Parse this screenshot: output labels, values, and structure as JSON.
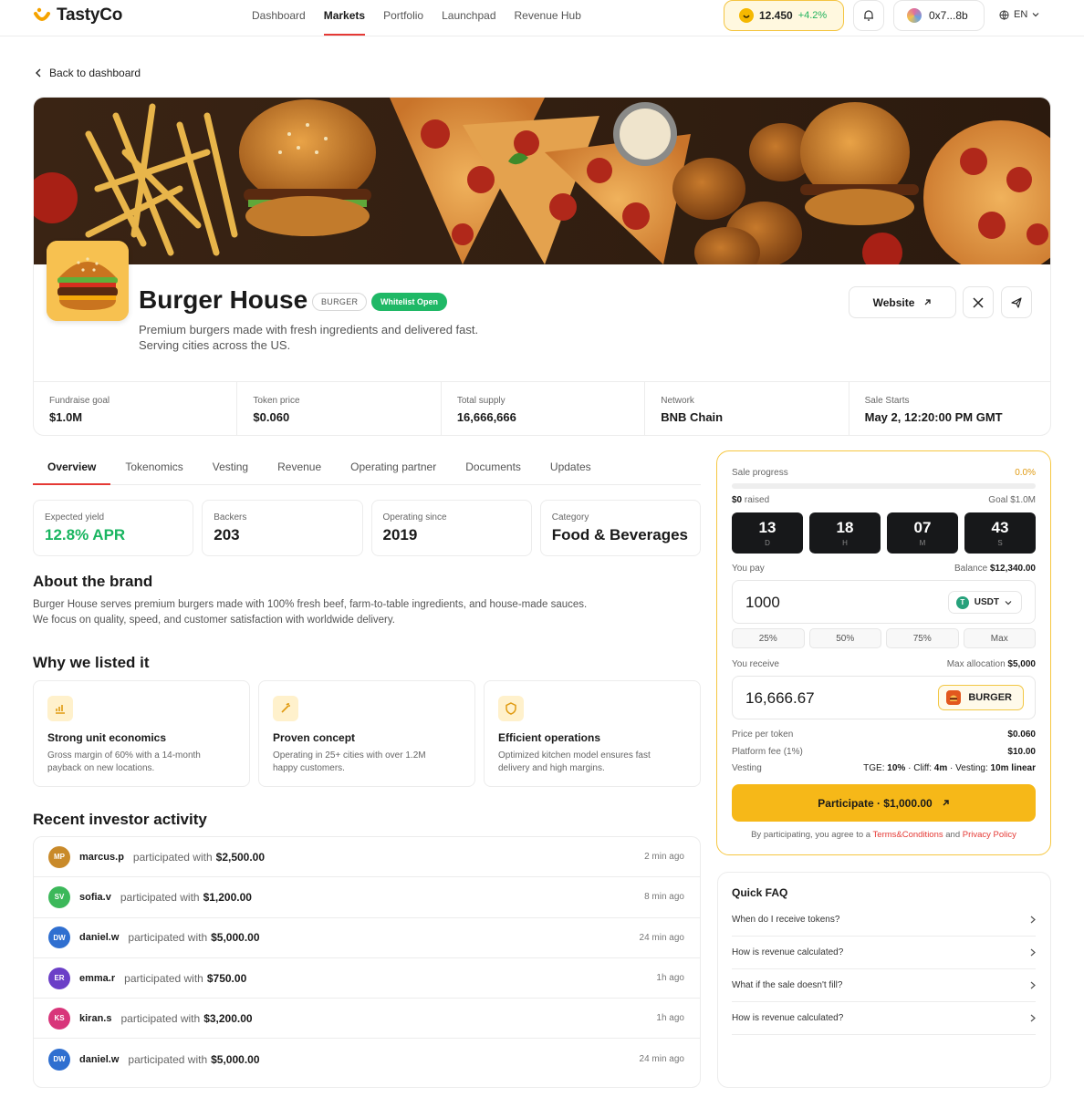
{
  "brand": {
    "name": "TastyCo"
  },
  "nav": {
    "links": [
      "Dashboard",
      "Markets",
      "Portfolio",
      "Launchpad",
      "Revenue Hub"
    ],
    "active": "Markets"
  },
  "header": {
    "balance": "12.450",
    "balance_change": "+4.2%",
    "wallet": "0x7...8b",
    "language": "EN"
  },
  "back_link": "Back to dashboard",
  "project": {
    "name": "Burger House",
    "ticker": "BURGER",
    "status": "Whitelist Open",
    "description_line1": "Premium burgers made with fresh ingredients and delivered fast.",
    "description_line2": "Serving cities across the US.",
    "website_label": "Website"
  },
  "stats": [
    {
      "label": "Fundraise goal",
      "value": "$1.0M"
    },
    {
      "label": "Token price",
      "value": "$0.060"
    },
    {
      "label": "Total supply",
      "value": "16,666,666"
    },
    {
      "label": "Network",
      "value": "BNB Chain"
    },
    {
      "label": "Sale Starts",
      "value": "May 2, 12:20:00 PM GMT"
    }
  ],
  "tabs": [
    "Overview",
    "Tokenomics",
    "Vesting",
    "Revenue",
    "Operating partner",
    "Documents",
    "Updates"
  ],
  "metrics": [
    {
      "label": "Expected yield",
      "value": "12.8% APR"
    },
    {
      "label": "Backers",
      "value": "203"
    },
    {
      "label": "Operating since",
      "value": "2019"
    },
    {
      "label": "Category",
      "value": "Food & Beverages"
    }
  ],
  "about": {
    "title": "About the brand",
    "line1": "Burger House serves premium burgers made with 100% fresh beef, farm-to-table ingredients, and house-made sauces.",
    "line2": "We focus on quality, speed, and customer satisfaction with worldwide delivery."
  },
  "why": {
    "title": "Why we listed it",
    "items": [
      {
        "icon": "chart-icon",
        "title": "Strong unit economics",
        "text": "Gross margin of 60% with a 14-month payback on new locations."
      },
      {
        "icon": "wand-icon",
        "title": "Proven concept",
        "text": "Operating in 25+ cities with over 1.2M happy customers."
      },
      {
        "icon": "shield-icon",
        "title": "Efficient operations",
        "text": "Optimized kitchen model ensures fast delivery and high margins."
      }
    ]
  },
  "activity": {
    "title": "Recent investor activity",
    "verb": "participated with",
    "rows": [
      {
        "initials": "MP",
        "user": "marcus.p",
        "amount": "$2,500.00",
        "time": "2 min ago",
        "color": "#c98a2a"
      },
      {
        "initials": "SV",
        "user": "sofia.v",
        "amount": "$1,200.00",
        "time": "8 min ago",
        "color": "#3cb85a"
      },
      {
        "initials": "DW",
        "user": "daniel.w",
        "amount": "$5,000.00",
        "time": "24 min ago",
        "color": "#2f6fd0"
      },
      {
        "initials": "ER",
        "user": "emma.r",
        "amount": "$750.00",
        "time": "1h ago",
        "color": "#6b3fc7"
      },
      {
        "initials": "KS",
        "user": "kiran.s",
        "amount": "$3,200.00",
        "time": "1h ago",
        "color": "#d8357a"
      },
      {
        "initials": "DW",
        "user": "daniel.w",
        "amount": "$5,000.00",
        "time": "24 min ago",
        "color": "#2f6fd0"
      }
    ]
  },
  "sale": {
    "progress_label": "Sale progress",
    "progress_pct": "0.0%",
    "progress_fraction": 0.0,
    "raised_amount": "$0",
    "raised_suffix": "raised",
    "goal": "Goal $1.0M",
    "countdown": [
      {
        "value": "13",
        "unit": "D"
      },
      {
        "value": "18",
        "unit": "H"
      },
      {
        "value": "07",
        "unit": "M"
      },
      {
        "value": "43",
        "unit": "S"
      }
    ],
    "you_pay_label": "You pay",
    "balance_label": "Balance",
    "balance_value": "$12,340.00",
    "pay_amount": "1000",
    "pay_token": "USDT",
    "quick_amounts": [
      "25%",
      "50%",
      "75%",
      "Max"
    ],
    "you_receive_label": "You receive",
    "max_alloc_label": "Max allocation",
    "max_alloc_value": "$5,000",
    "receive_amount": "16,666.67",
    "receive_token": "BURGER",
    "price_label": "Price per token",
    "price_value": "$0.060",
    "fee_label": "Platform fee (1%)",
    "fee_value": "$10.00",
    "vesting_label": "Vesting",
    "vesting_tge_label": "TGE:",
    "vesting_tge": "10%",
    "vesting_cliff_label": "Cliff:",
    "vesting_cliff": "4m",
    "vesting_sched_label": "Vesting:",
    "vesting_sched": "10m linear",
    "cta": "Participate · $1,000.00",
    "terms_prefix": "By participating, you agree to a",
    "terms_link": "Terms&Conditions",
    "terms_and": "and",
    "privacy_link": "Privacy Policy"
  },
  "faq": {
    "title": "Quick FAQ",
    "items": [
      "When do I receive tokens?",
      "How is revenue calculated?",
      "What if the sale doesn't fill?",
      "How is revenue calculated?"
    ]
  },
  "colors": {
    "accent": "#f6b818",
    "active_tab": "#e53935",
    "success": "#1fb866"
  }
}
